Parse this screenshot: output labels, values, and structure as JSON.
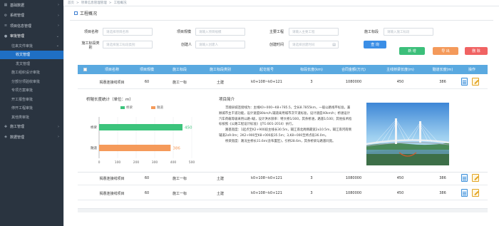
{
  "sidebar": {
    "items": [
      {
        "label": "基础数据",
        "icon": "grid-icon"
      },
      {
        "label": "系统管理",
        "icon": "gear-icon"
      },
      {
        "label": "项目信息管理",
        "icon": "list-icon"
      },
      {
        "label": "审批管理",
        "icon": "person-icon"
      }
    ],
    "sub": {
      "label": "往来文件审批"
    },
    "sub2": [
      {
        "label": "收文管理"
      },
      {
        "label": "发文管理"
      }
    ],
    "more": [
      {
        "label": "施工组织设计审批"
      },
      {
        "label": "分部分项验收审批"
      },
      {
        "label": "专项方案审批"
      },
      {
        "label": "开工报告审批"
      },
      {
        "label": "停开工程审批"
      },
      {
        "label": "其他类审批"
      }
    ],
    "bottom": [
      {
        "label": "施工管理",
        "icon": "tools-icon"
      },
      {
        "label": "数据管理",
        "icon": "database-icon"
      }
    ]
  },
  "breadcrumb": [
    "首页",
    ">",
    "项目信息管理管理",
    ">",
    "工程概况"
  ],
  "page_title": "工程概况",
  "filters": {
    "project_name": {
      "label": "项目名称",
      "placeholder": "请选择项目名称"
    },
    "project_scale": {
      "label": "项目规模",
      "placeholder": "请输入项目规模"
    },
    "main_works": {
      "label": "主要工程",
      "placeholder": "请输入主要工程"
    },
    "section": {
      "label": "施工标段",
      "placeholder": "请输入施工标段"
    },
    "section_type": {
      "label": "施工标段类别",
      "placeholder": "请选择施工标段类别"
    },
    "creator": {
      "label": "创建人",
      "placeholder": "请输入创建人"
    },
    "created_time": {
      "label": "创建时间",
      "placeholder": "请选择创建时间"
    }
  },
  "buttons": {
    "query": "查  询",
    "add": "新  增",
    "import": "导  出",
    "delete": "删  除"
  },
  "colors": {
    "query": "#3a8ee6",
    "add": "#3cbf7a",
    "import": "#f49a5b",
    "delete": "#f06363",
    "header": "#5aa9e0"
  },
  "table": {
    "headers": [
      "项目名称",
      "项目规模",
      "施工标段",
      "施工标段类别",
      "起讫桩号",
      "标段长度(km)",
      "合同金额(万元)",
      "主线桥梁长度(m)",
      "隧道长度(m)",
      "操作"
    ],
    "rows": [
      [
        "揭惠连接线项目",
        "60",
        "施工一标",
        "土建",
        "k0+108~k0+121",
        "3",
        "1080000",
        "450",
        "386"
      ],
      [
        "揭惠连接线项目",
        "60",
        "施工一标",
        "土建",
        "k0+108~k0+121",
        "3",
        "1080000",
        "450",
        "386"
      ],
      [
        "揭惠连接线项目",
        "60",
        "施工一标",
        "土建",
        "k0+108~k0+121",
        "3",
        "1080000",
        "450",
        "386"
      ]
    ]
  },
  "detail": {
    "chart_title": "桥隧长度统计（单位：m）",
    "intro_title": "项目简介",
    "intro_p1": "丰顺县城连接线为：主线K0+000~K8+785.5，全长8.7855km，一般公路线平标准，兼顾城市主干道功能，设计速度80km/h,辅道采用城市次干道标准，设计速度40km/h；桥涵设计汽车荷载等级采用公路-I级，设计洪水频率：特大桥1/300，其余桥涵，路基1/100；其他技术指标按照《公路工程设计标准》（JTG B01-2014）执行。",
    "intro_p2": "路基宽度：1起点至K2+900段主线长30.5m，辅江南北两侧最宽2x10.5m，辅江南河南侧辅道2x9.0m；2K2+900至K8+000段35.5m；3,K8+000至终点段36.0m。",
    "intro_p3": "桥梁宽度：路况主桥长31.6m(含布置区)，引桥28.6m，其余桥梁与路基同宽。"
  },
  "chart_data": {
    "type": "bar",
    "orientation": "horizontal",
    "title": "桥隧长度统计（单位：m）",
    "categories": [
      "桥梁",
      "隧道"
    ],
    "values": [
      450,
      386
    ],
    "colors": [
      "#3cc47c",
      "#f59a5a"
    ],
    "xlim": [
      0,
      500
    ],
    "xticks": [
      0,
      100,
      200,
      300,
      400,
      500
    ],
    "legend": "top",
    "grid": true
  }
}
